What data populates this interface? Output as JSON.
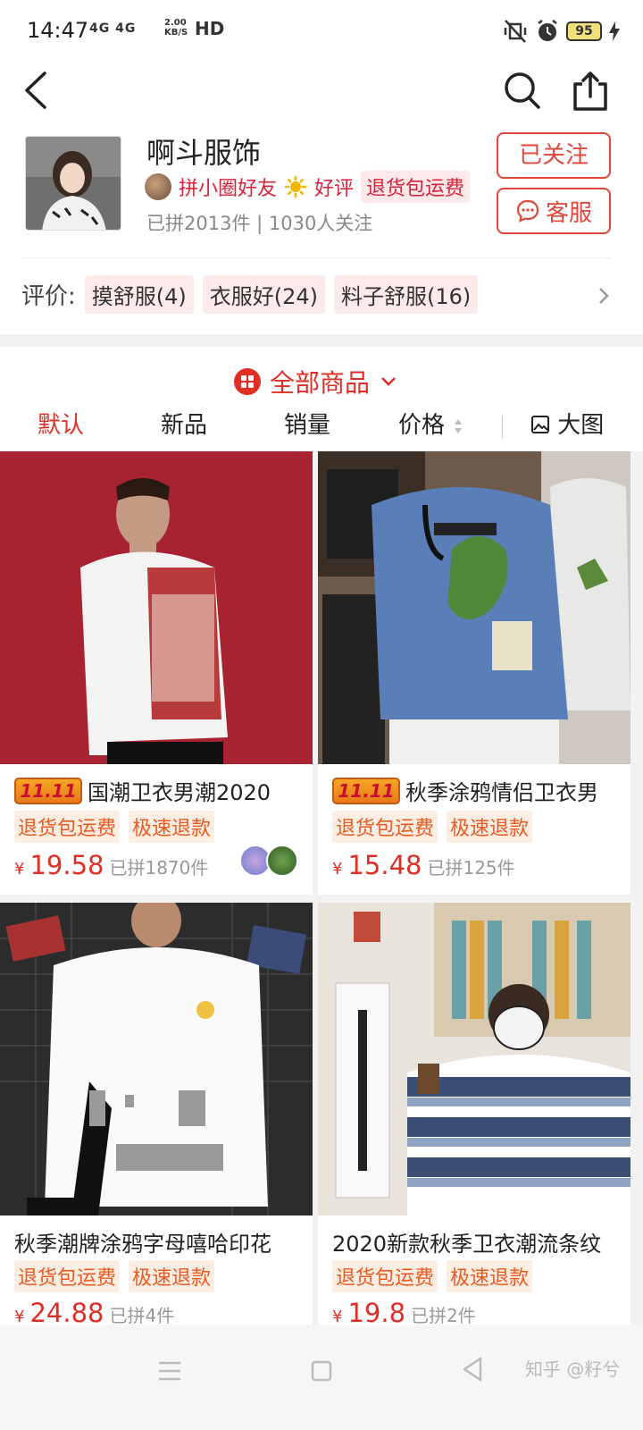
{
  "status_bar": {
    "time": "14:47",
    "network": "4G 4G",
    "speed_value": "2.00",
    "speed_unit": "KB/S",
    "hd": "HD",
    "battery": "95"
  },
  "store": {
    "name": "啊斗服饰",
    "friend_badge": "拼小圈好友",
    "good_review": "好评",
    "return_tag": "退货包运费",
    "stats": "已拼2013件 | 1030人关注",
    "follow_label": "已关注",
    "service_label": "客服"
  },
  "reviews": {
    "label": "评价:",
    "tags": [
      "摸舒服(4)",
      "衣服好(24)",
      "料子舒服(16)"
    ]
  },
  "catalog": {
    "all_label": "全部商品",
    "sort": [
      "默认",
      "新品",
      "销量",
      "价格",
      "大图"
    ]
  },
  "products": [
    {
      "title": "国潮卫衣男潮2020",
      "promo": "11.11",
      "tags": [
        "退货包运费",
        "极速退款"
      ],
      "currency": "¥",
      "price": "19.58",
      "sold": "已拼1870件"
    },
    {
      "title": "秋季涂鸦情侣卫衣男",
      "promo": "11.11",
      "tags": [
        "退货包运费",
        "极速退款"
      ],
      "currency": "¥",
      "price": "15.48",
      "sold": "已拼125件"
    },
    {
      "title": "秋季潮牌涂鸦字母嘻哈印花",
      "tags": [
        "退货包运费",
        "极速退款"
      ],
      "currency": "¥",
      "price": "24.88",
      "sold": "已拼4件"
    },
    {
      "title": "2020新款秋季卫衣潮流条纹",
      "tags": [
        "退货包运费",
        "极速退款"
      ],
      "currency": "¥",
      "price": "19.8",
      "sold": "已拼2件"
    }
  ],
  "watermark": "知乎 @籽兮",
  "colors": {
    "accent": "#e02e24",
    "tag_orange": "#ec5a20",
    "background": "#f2f2f2"
  }
}
